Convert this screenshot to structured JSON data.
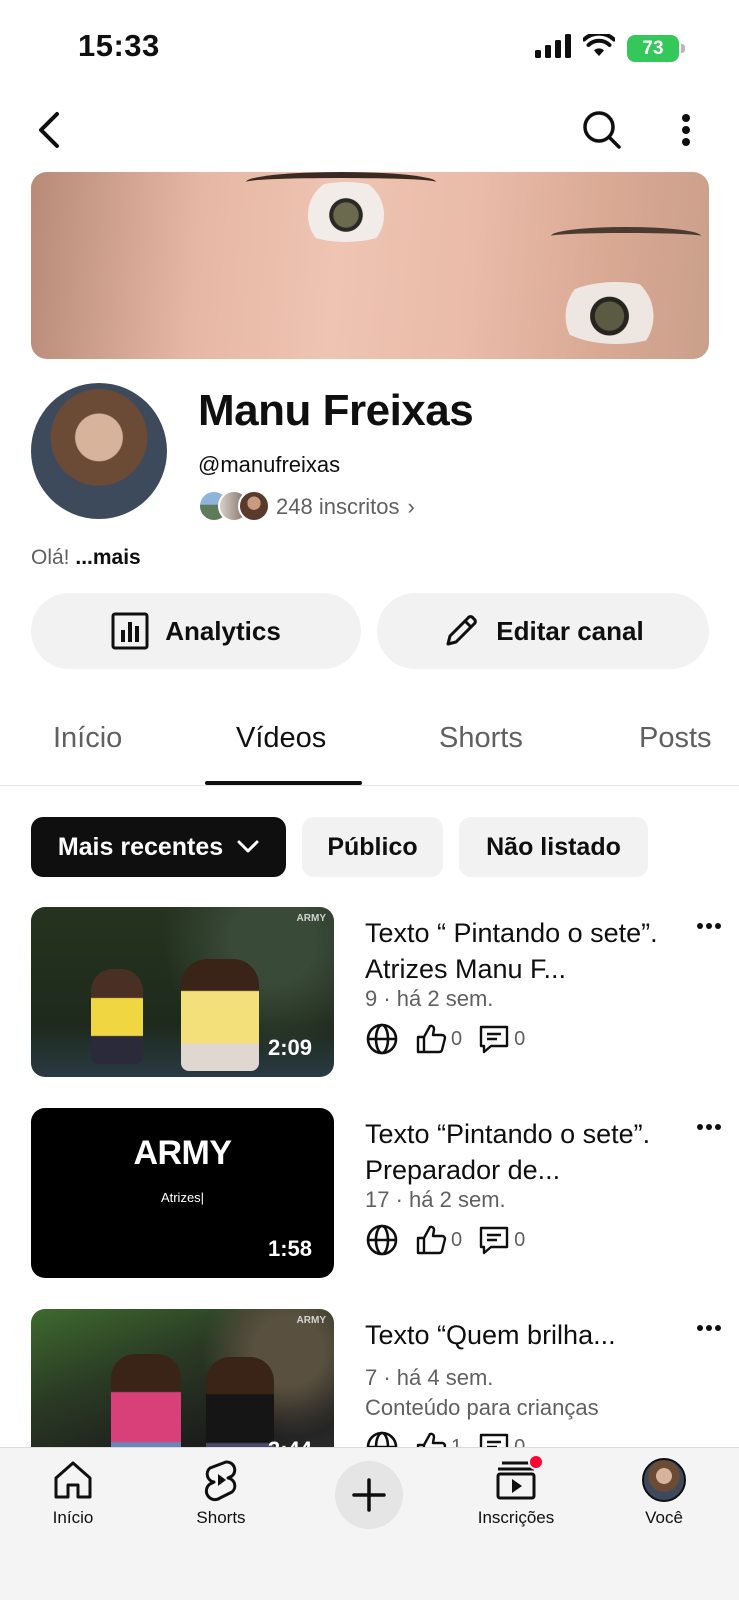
{
  "status_bar": {
    "time": "15:33",
    "battery": "73"
  },
  "channel": {
    "name": "Manu Freixas",
    "handle": "@manufreixas",
    "subscribers": "248 inscritos",
    "about_text": "Olá!",
    "about_more": "...mais"
  },
  "actions": {
    "analytics_label": "Analytics",
    "edit_label": "Editar canal"
  },
  "tabs": [
    {
      "label": "Início"
    },
    {
      "label": "Vídeos"
    },
    {
      "label": "Shorts"
    },
    {
      "label": "Posts"
    }
  ],
  "active_tab": "Vídeos",
  "filters": {
    "sort_label": "Mais recentes",
    "public_label": "Público",
    "unlisted_label": "Não listado"
  },
  "videos": [
    {
      "title": "Texto “ Pintando o sete”. Atrizes Manu F...",
      "meta": "9 · há 2 sem.",
      "likes": "0",
      "comments": "0",
      "duration": "2:09",
      "thumb_brand": "ARMY"
    },
    {
      "title": "Texto “Pintando o sete”. Preparador de...",
      "meta": "17 · há 2 sem.",
      "likes": "0",
      "comments": "0",
      "duration": "1:58",
      "thumb_logo": "ARMY",
      "thumb_caption": "Atrizes|"
    },
    {
      "title": "Texto  “Quem brilha...",
      "meta": "7 · há 4 sem.",
      "extra": "Conteúdo para crianças",
      "likes": "1",
      "comments": "0",
      "duration": "3:44",
      "thumb_brand": "ARMY"
    }
  ],
  "bottom_nav": {
    "home_label": "Início",
    "shorts_label": "Shorts",
    "subscriptions_label": "Inscrições",
    "you_label": "Você"
  },
  "colors": {
    "accent": "#0f0f0f",
    "chip_bg": "#f2f2f2",
    "badge_red": "#ff0033",
    "battery_green": "#34c759"
  }
}
